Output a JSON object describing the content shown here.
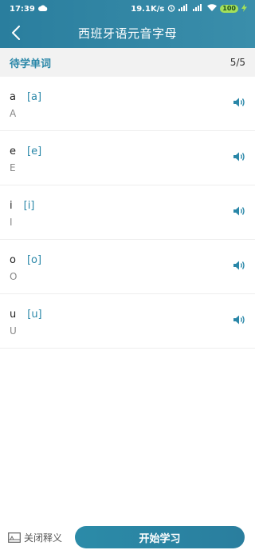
{
  "status_bar": {
    "time": "17:39",
    "network_speed": "19.1K/s",
    "battery": "100"
  },
  "nav": {
    "title": "西班牙语元音字母"
  },
  "subheader": {
    "label": "待学单词",
    "count": "5/5"
  },
  "items": [
    {
      "letter": "a",
      "ipa": "[a]",
      "upper": "A"
    },
    {
      "letter": "e",
      "ipa": "[e]",
      "upper": "E"
    },
    {
      "letter": "i",
      "ipa": "[i]",
      "upper": "I"
    },
    {
      "letter": "o",
      "ipa": "[o]",
      "upper": "O"
    },
    {
      "letter": "u",
      "ipa": "[u]",
      "upper": "U"
    }
  ],
  "footer": {
    "toggle_label": "关闭释义",
    "start_label": "开始学习"
  },
  "colors": {
    "accent": "#2a87a8",
    "header": "#2a7e9e"
  }
}
